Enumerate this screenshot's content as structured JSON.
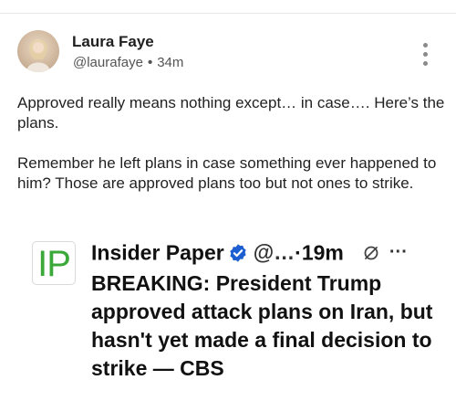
{
  "post": {
    "author": {
      "name": "Laura Faye",
      "handle": "@laurafaye",
      "separator": "•",
      "time": "34m"
    },
    "paragraphs": [
      "Approved really means nothing except… in case…. Here’s the plans.",
      "Remember he left plans in case something ever happened to him? Those are approved plans too but not ones to strike."
    ],
    "icons": {
      "avatar": "avatar-photo",
      "more": "vertical-ellipsis-icon"
    }
  },
  "quoted_post": {
    "logo_text": "IP",
    "logo_color": "#3aa93a",
    "account": "Insider Paper",
    "handle": "@…",
    "separator": "·",
    "time": "19m",
    "more": "···",
    "body": "BREAKING: President Trump approved attack plans on Iran, but hasn't yet made a final decision to strike — CBS",
    "icons": {
      "verified": "verified-badge-icon",
      "mute": "mute-icon"
    },
    "verified_color": "#1d5fd1"
  }
}
